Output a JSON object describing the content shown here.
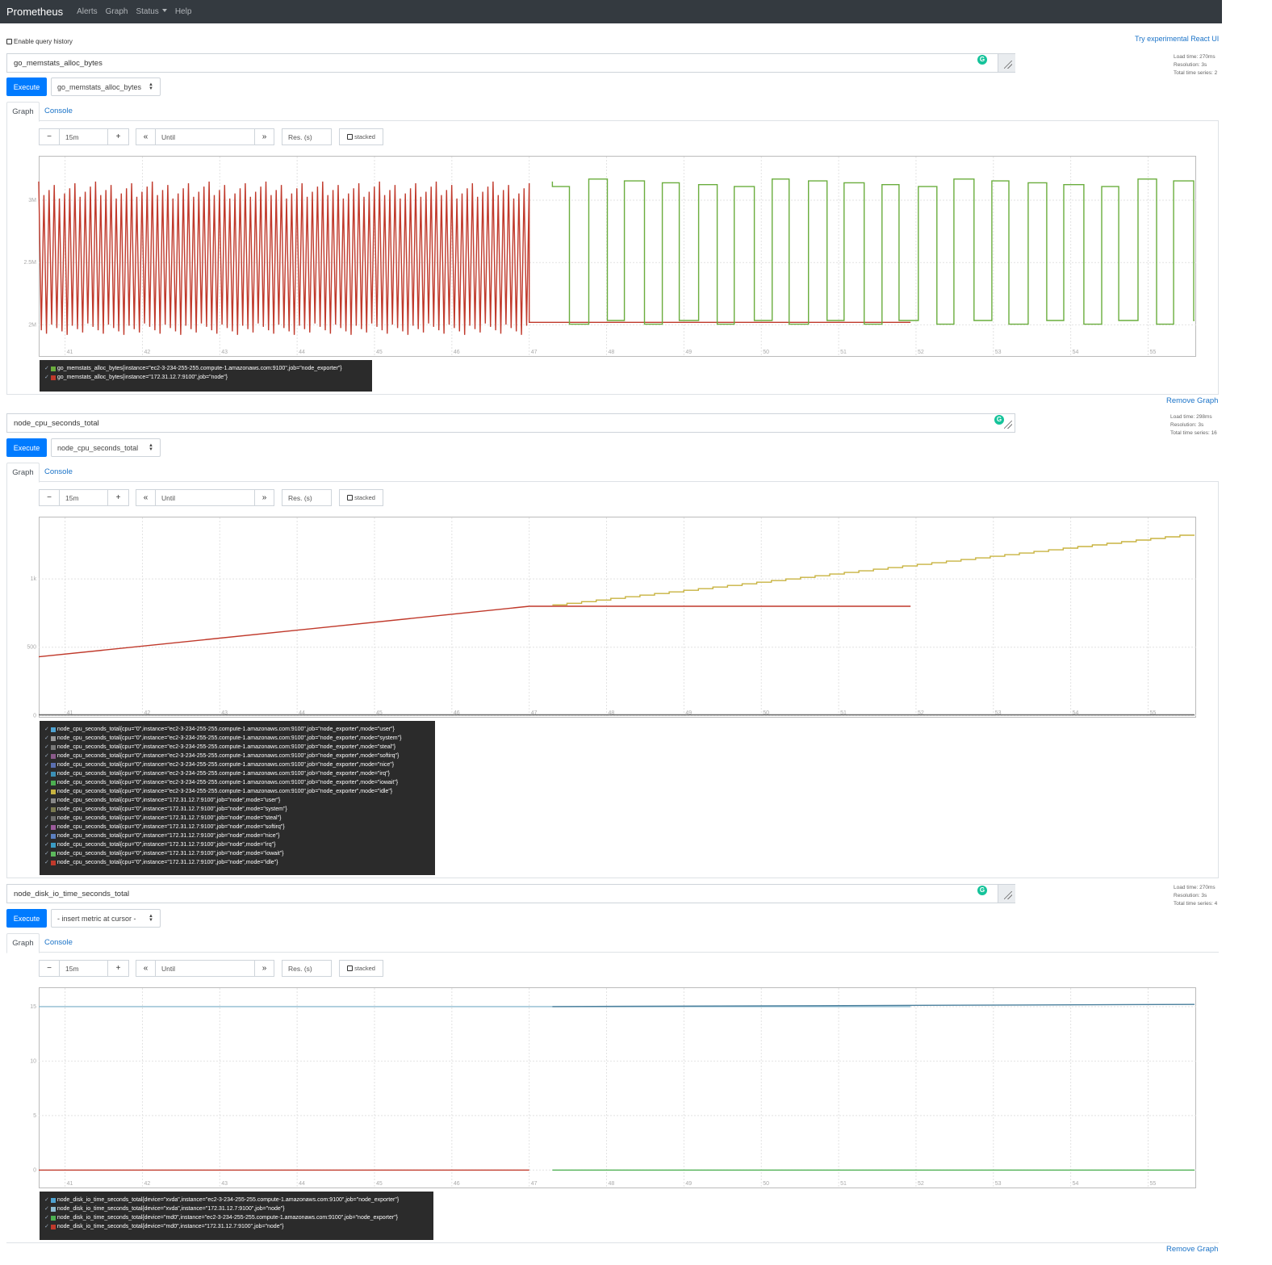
{
  "navbar": {
    "brand": "Prometheus",
    "links": [
      "Alerts",
      "Graph",
      "Status",
      "Help"
    ]
  },
  "history_label": "Enable query history",
  "react_link": "Try experimental React UI",
  "panels": [
    {
      "expression": "go_memstats_alloc_bytes",
      "stats": [
        "Load time: 270ms",
        "Resolution: 3s",
        "Total time series: 2"
      ],
      "execute": "Execute",
      "metric_select": "go_memstats_alloc_bytes",
      "tabs": {
        "graph": "Graph",
        "console": "Console"
      },
      "range": "15m",
      "until_placeholder": "Until",
      "res_placeholder": "Res. (s)",
      "stacked": "stacked",
      "legend": [
        {
          "label": "go_memstats_alloc_bytes{instance=\"ec2-3-234-255-255.compute-1.amazonaws.com:9100\",job=\"node_exporter\"}",
          "color": "#6aad3d"
        },
        {
          "label": "go_memstats_alloc_bytes{instance=\"172.31.12.7:9100\",job=\"node\"}",
          "color": "#c0392b"
        }
      ],
      "remove": "Remove Graph",
      "chart_data": {
        "type": "line",
        "x_ticks": [
          "41",
          "42",
          "43",
          "44",
          "45",
          "46",
          "47",
          "48",
          "49",
          "50",
          "51",
          "52",
          "53",
          "54",
          "55"
        ],
        "y_ticks": [
          "2M",
          "2.5M",
          "3M"
        ],
        "ylim": [
          1750000,
          3350000
        ],
        "series": [
          {
            "name": "go_memstats_alloc_bytes{instance=\"172.31.12.7:9100\",job=\"node\"}",
            "color": "#c0392b",
            "shape": "oscillating",
            "x_range": [
              40.66,
              47.0
            ],
            "low": 2000000,
            "high": 3150000,
            "then_flat": 2020000,
            "flat_until": 51.93
          },
          {
            "name": "go_memstats_alloc_bytes{instance=\"ec2-3-234-255-255.compute-1.amazonaws.com:9100\",job=\"node_exporter\"}",
            "color": "#6aad3d",
            "shape": "square",
            "x_range": [
              47.3,
              55.6
            ],
            "low": 2010000,
            "high": 3150000
          }
        ]
      }
    },
    {
      "expression": "node_cpu_seconds_total",
      "stats": [
        "Load time: 298ms",
        "Resolution: 3s",
        "Total time series: 16"
      ],
      "execute": "Execute",
      "metric_select": "node_cpu_seconds_total",
      "tabs": {
        "graph": "Graph",
        "console": "Console"
      },
      "range": "15m",
      "until_placeholder": "Until",
      "res_placeholder": "Res. (s)",
      "stacked": "stacked",
      "legend": [
        {
          "label": "node_cpu_seconds_total{cpu=\"0\",instance=\"ec2-3-234-255-255.compute-1.amazonaws.com:9100\",job=\"node_exporter\",mode=\"user\"}",
          "color": "#4fa3d1"
        },
        {
          "label": "node_cpu_seconds_total{cpu=\"0\",instance=\"ec2-3-234-255-255.compute-1.amazonaws.com:9100\",job=\"node_exporter\",mode=\"system\"}",
          "color": "#999999"
        },
        {
          "label": "node_cpu_seconds_total{cpu=\"0\",instance=\"ec2-3-234-255-255.compute-1.amazonaws.com:9100\",job=\"node_exporter\",mode=\"steal\"}",
          "color": "#777777"
        },
        {
          "label": "node_cpu_seconds_total{cpu=\"0\",instance=\"ec2-3-234-255-255.compute-1.amazonaws.com:9100\",job=\"node_exporter\",mode=\"softirq\"}",
          "color": "#8a5a8a"
        },
        {
          "label": "node_cpu_seconds_total{cpu=\"0\",instance=\"ec2-3-234-255-255.compute-1.amazonaws.com:9100\",job=\"node_exporter\",mode=\"nice\"}",
          "color": "#5a6fb0"
        },
        {
          "label": "node_cpu_seconds_total{cpu=\"0\",instance=\"ec2-3-234-255-255.compute-1.amazonaws.com:9100\",job=\"node_exporter\",mode=\"irq\"}",
          "color": "#3b8fb5"
        },
        {
          "label": "node_cpu_seconds_total{cpu=\"0\",instance=\"ec2-3-234-255-255.compute-1.amazonaws.com:9100\",job=\"node_exporter\",mode=\"iowait\"}",
          "color": "#4caf50"
        },
        {
          "label": "node_cpu_seconds_total{cpu=\"0\",instance=\"ec2-3-234-255-255.compute-1.amazonaws.com:9100\",job=\"node_exporter\",mode=\"idle\"}",
          "color": "#c8b340"
        },
        {
          "label": "node_cpu_seconds_total{cpu=\"0\",instance=\"172.31.12.7:9100\",job=\"node\",mode=\"user\"}",
          "color": "#888888"
        },
        {
          "label": "node_cpu_seconds_total{cpu=\"0\",instance=\"172.31.12.7:9100\",job=\"node\",mode=\"system\"}",
          "color": "#7a7a50"
        },
        {
          "label": "node_cpu_seconds_total{cpu=\"0\",instance=\"172.31.12.7:9100\",job=\"node\",mode=\"steal\"}",
          "color": "#6d6d6d"
        },
        {
          "label": "node_cpu_seconds_total{cpu=\"0\",instance=\"172.31.12.7:9100\",job=\"node\",mode=\"softirq\"}",
          "color": "#9b5a9b"
        },
        {
          "label": "node_cpu_seconds_total{cpu=\"0\",instance=\"172.31.12.7:9100\",job=\"node\",mode=\"nice\"}",
          "color": "#5b7fc0"
        },
        {
          "label": "node_cpu_seconds_total{cpu=\"0\",instance=\"172.31.12.7:9100\",job=\"node\",mode=\"irq\"}",
          "color": "#3a9cc4"
        },
        {
          "label": "node_cpu_seconds_total{cpu=\"0\",instance=\"172.31.12.7:9100\",job=\"node\",mode=\"iowait\"}",
          "color": "#5cb85c"
        },
        {
          "label": "node_cpu_seconds_total{cpu=\"0\",instance=\"172.31.12.7:9100\",job=\"node\",mode=\"idle\"}",
          "color": "#c0392b"
        }
      ],
      "remove": "",
      "chart_data": {
        "type": "line",
        "x_ticks": [
          "41",
          "42",
          "43",
          "44",
          "45",
          "46",
          "47",
          "48",
          "49",
          "50",
          "51",
          "52",
          "53",
          "54",
          "55"
        ],
        "y_ticks": [
          "0",
          "500",
          "1k"
        ],
        "ylim": [
          -10,
          1450
        ],
        "series": [
          {
            "name": "node_cpu_seconds_total{cpu=\"0\",instance=\"172.31.12.7:9100\",job=\"node\",mode=\"idle\"}",
            "color": "#c0392b",
            "shape": "ramp_then_flat",
            "x_range": [
              40.66,
              47.0
            ],
            "start": 430,
            "end": 800,
            "flat_until": 51.93
          },
          {
            "name": "node_cpu_seconds_total{cpu=\"0\",instance=\"ec2-3-234-255-255.compute-1.amazonaws.com:9100\",job=\"node_exporter\",mode=\"idle\"}",
            "color": "#c8b340",
            "shape": "staircase",
            "x_range": [
              47.3,
              55.6
            ],
            "start": 810,
            "end": 1320
          },
          {
            "name": "node_cpu_seconds_total (near zero, other modes)",
            "color": "#666666",
            "shape": "flat",
            "x_range": [
              40.66,
              55.6
            ],
            "value": 5
          }
        ]
      }
    },
    {
      "expression": "node_disk_io_time_seconds_total",
      "stats": [
        "Load time: 270ms",
        "Resolution: 3s",
        "Total time series: 4"
      ],
      "execute": "Execute",
      "metric_select": "- insert metric at cursor -",
      "tabs": {
        "graph": "Graph",
        "console": "Console"
      },
      "range": "15m",
      "until_placeholder": "Until",
      "res_placeholder": "Res. (s)",
      "stacked": "stacked",
      "legend": [
        {
          "label": "node_disk_io_time_seconds_total{device=\"xvda\",instance=\"ec2-3-234-255-255.compute-1.amazonaws.com:9100\",job=\"node_exporter\"}",
          "color": "#4fa3d1"
        },
        {
          "label": "node_disk_io_time_seconds_total{device=\"xvda\",instance=\"172.31.12.7:9100\",job=\"node\"}",
          "color": "#8fbcd0"
        },
        {
          "label": "node_disk_io_time_seconds_total{device=\"md0\",instance=\"ec2-3-234-255-255.compute-1.amazonaws.com:9100\",job=\"node_exporter\"}",
          "color": "#4caf50"
        },
        {
          "label": "node_disk_io_time_seconds_total{device=\"md0\",instance=\"172.31.12.7:9100\",job=\"node\"}",
          "color": "#c0392b"
        }
      ],
      "remove": "Remove Graph",
      "chart_data": {
        "type": "line",
        "x_ticks": [
          "41",
          "42",
          "43",
          "44",
          "45",
          "46",
          "47",
          "48",
          "49",
          "50",
          "51",
          "52",
          "53",
          "54",
          "55"
        ],
        "y_ticks": [
          "0",
          "5",
          "10",
          "15"
        ],
        "ylim": [
          -1.6,
          16.7
        ],
        "series": [
          {
            "name": "node_disk_io_time_seconds_total{device=\"xvda\",instance=\"172.31.12.7:9100\",job=\"node\"}",
            "color": "#8fbcd0",
            "shape": "flat",
            "x_range": [
              40.66,
              51.93
            ],
            "value": 15.0
          },
          {
            "name": "node_disk_io_time_seconds_total{device=\"xvda\",instance=\"ec2-3-234-255-255.compute-1.amazonaws.com:9100\",job=\"node_exporter\"}",
            "color": "#4a7f9c",
            "shape": "slow_ramp",
            "x_range": [
              47.3,
              55.6
            ],
            "start": 15.0,
            "end": 15.2
          },
          {
            "name": "node_disk_io_time_seconds_total{device=\"md0\",instance=\"172.31.12.7:9100\",job=\"node\"}",
            "color": "#c0392b",
            "shape": "flat",
            "x_range": [
              40.66,
              47.0
            ],
            "value": 0.0
          },
          {
            "name": "node_disk_io_time_seconds_total{device=\"md0\",instance=\"ec2-3-234-255-255.compute-1.amazonaws.com:9100\",job=\"node_exporter\"}",
            "color": "#4caf50",
            "shape": "flat",
            "x_range": [
              47.3,
              55.6
            ],
            "value": 0.0
          }
        ]
      }
    }
  ]
}
